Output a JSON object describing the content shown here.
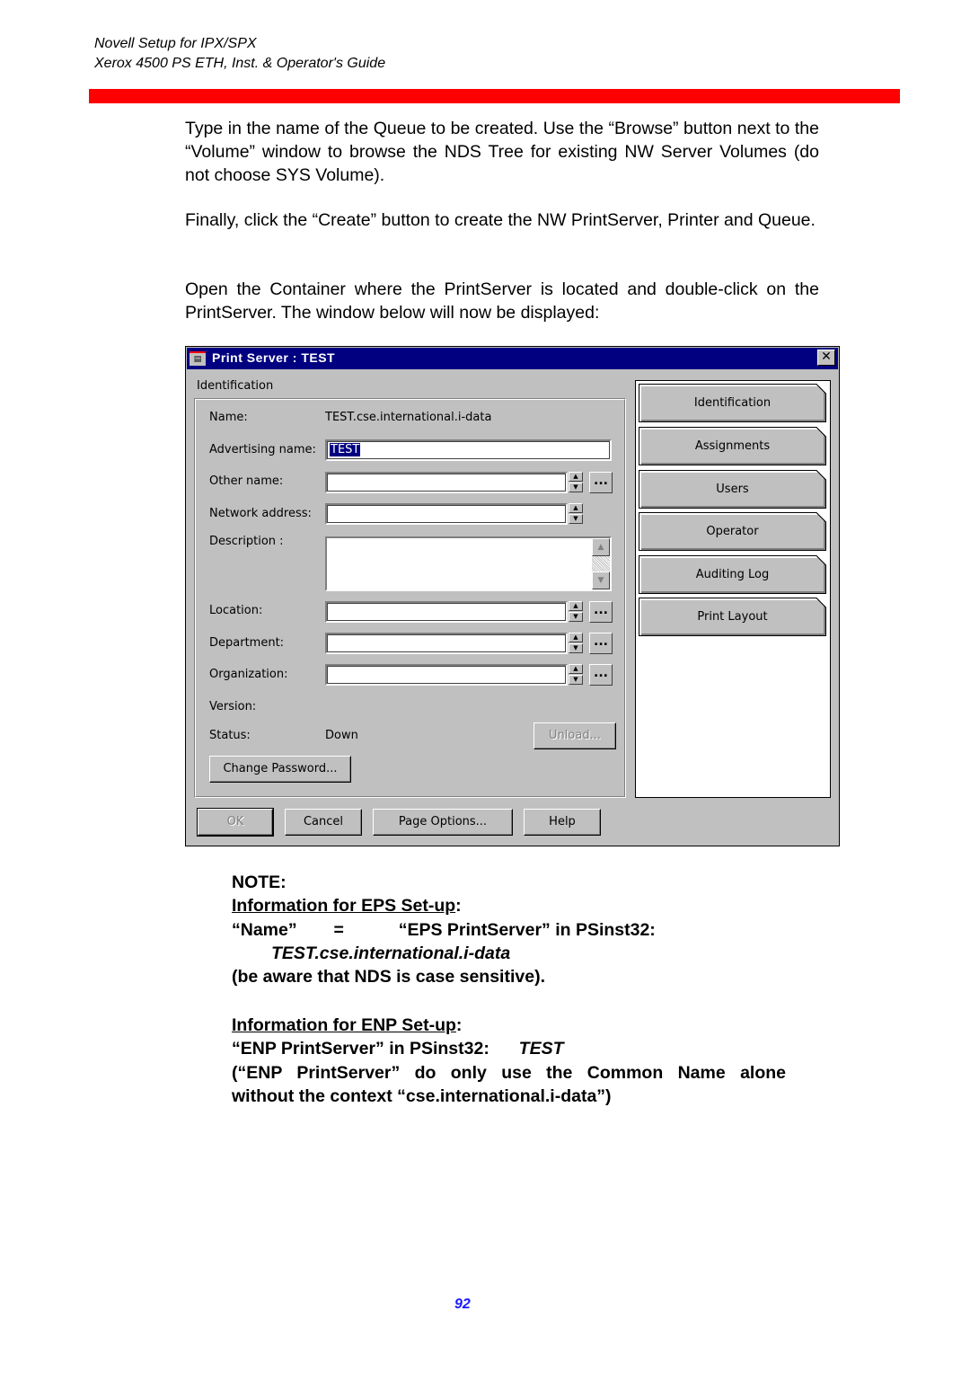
{
  "header": {
    "line1": "Novell Setup for IPX/SPX",
    "line2": "Xerox 4500 PS ETH, Inst. & Operator's Guide",
    "accent_color": "#ff0000"
  },
  "paragraphs": [
    "Type in the name of the Queue to be created. Use the “Browse” button next to the “Volume” window to browse the NDS Tree for existing NW Server Volumes (do not choose SYS Volume).",
    "Finally, click the “Create” button to create the NW PrintServer, Printer and Queue.",
    "Open the Container where the PrintServer is located and double-click on the PrintServer. The window below will now be displayed:"
  ],
  "dialog": {
    "title": "Print Server : TEST",
    "close_label": "✕",
    "group_label": "Identification",
    "fields": {
      "name_label": "Name:",
      "name_value": "TEST.cse.international.i-data",
      "advertising_label": "Advertising name:",
      "advertising_value": "TEST",
      "other_name_label": "Other name:",
      "other_name_value": "",
      "network_address_label": "Network address:",
      "network_address_value": "",
      "description_label": "Description :",
      "description_value": "",
      "location_label": "Location:",
      "location_value": "",
      "department_label": "Department:",
      "department_value": "",
      "organization_label": "Organization:",
      "organization_value": "",
      "version_label": "Version:",
      "version_value": "",
      "status_label": "Status:",
      "status_value": "Down"
    },
    "browse_label": "...",
    "unload_label": "Unload...",
    "change_password_label": "Change Password...",
    "page_buttons": [
      "Identification",
      "Assignments",
      "Users",
      "Operator",
      "Auditing Log",
      "Print Layout"
    ],
    "footer": {
      "ok": "OK",
      "cancel": "Cancel",
      "page_options": "Page Options...",
      "help": "Help"
    }
  },
  "note": {
    "heading": "NOTE:",
    "eps_heading": "Information for EPS Set-up",
    "colon": ":",
    "eps_line_left": "“Name”",
    "eps_line_eq": "=",
    "eps_line_right": "“EPS PrintServer” in PSinst32:",
    "eps_value": "TEST.cse.international.i-data",
    "eps_remark": "(be aware that NDS is case sensitive).",
    "enp_heading": "Information for ENP Set-up",
    "enp_line": "“ENP PrintServer” in PSinst32:",
    "enp_value": "TEST",
    "enp_remark_1": "(“ENP PrintServer” do only use the Common Name alone",
    "enp_remark_2": "without the context “cse.international.i-data”)"
  },
  "page_number": "92"
}
